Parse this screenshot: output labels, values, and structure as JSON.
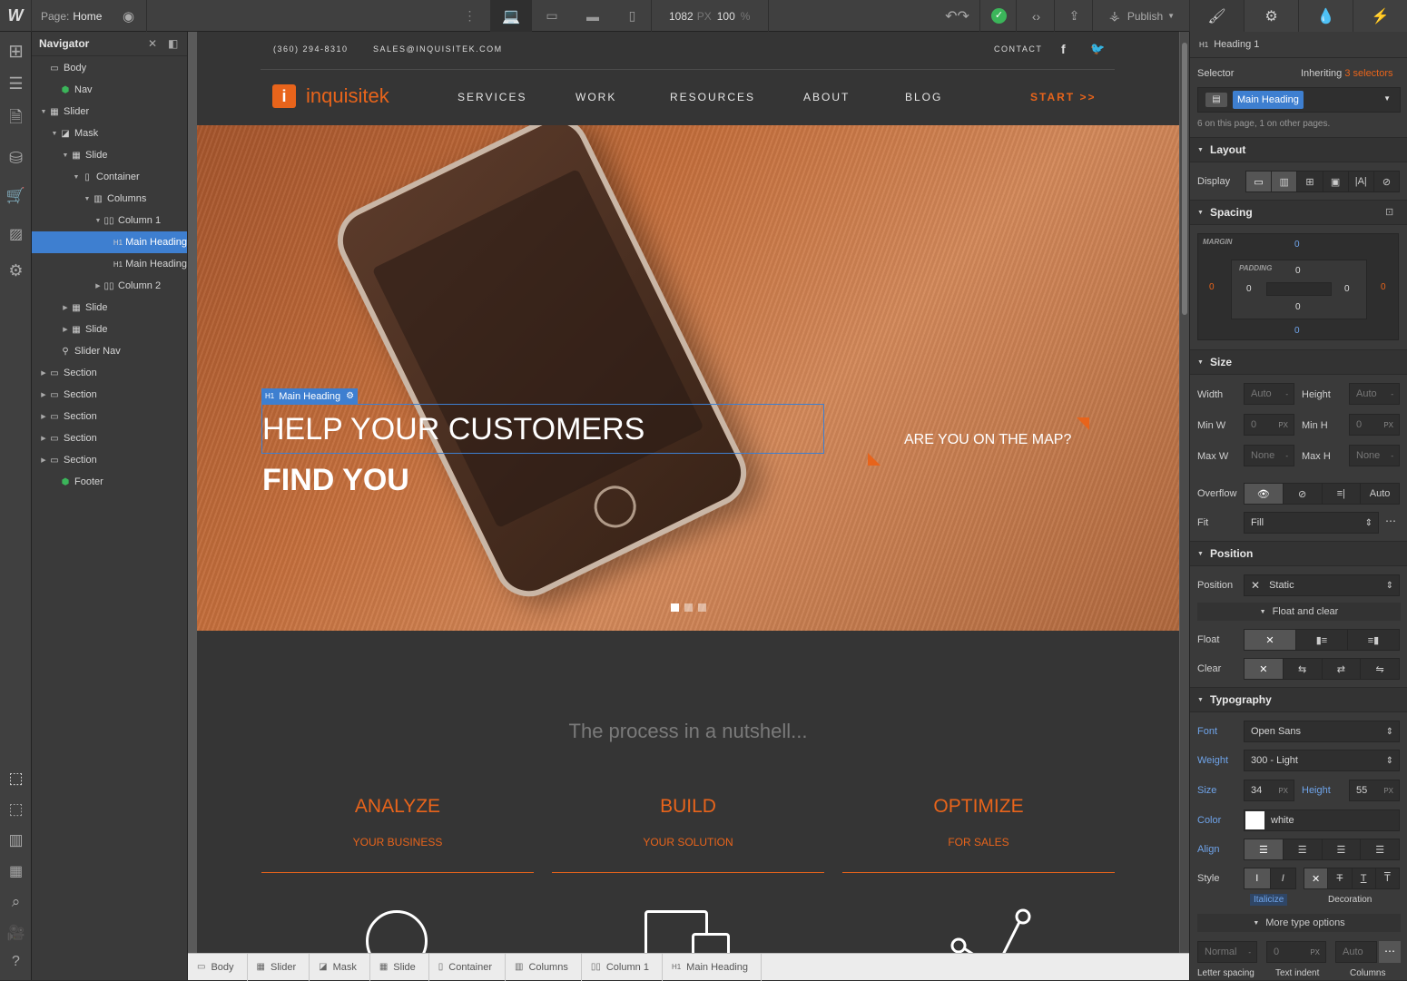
{
  "topbar": {
    "logo": "W",
    "page_label": "Page:",
    "page_name": "Home",
    "width_value": "1082",
    "width_unit": "PX",
    "zoom_value": "100",
    "zoom_unit": "%",
    "publish_label": "Publish"
  },
  "navigator": {
    "title": "Navigator",
    "items": [
      {
        "label": "Body",
        "icon": "▭"
      },
      {
        "label": "Nav",
        "icon": "⬢"
      },
      {
        "label": "Slider",
        "icon": "▦"
      },
      {
        "label": "Mask",
        "icon": "◪"
      },
      {
        "label": "Slide",
        "icon": "▦"
      },
      {
        "label": "Container",
        "icon": "▯"
      },
      {
        "label": "Columns",
        "icon": "▥"
      },
      {
        "label": "Column 1",
        "icon": "▯▯"
      },
      {
        "label": "Main Heading",
        "icon": "H1"
      },
      {
        "label": "Main Heading",
        "icon": "H1"
      },
      {
        "label": "Column 2",
        "icon": "▯▯"
      },
      {
        "label": "Slide",
        "icon": "▦"
      },
      {
        "label": "Slide",
        "icon": "▦"
      },
      {
        "label": "Slider Nav",
        "icon": "⚲"
      },
      {
        "label": "Section",
        "icon": "▭"
      },
      {
        "label": "Section",
        "icon": "▭"
      },
      {
        "label": "Section",
        "icon": "▭"
      },
      {
        "label": "Section",
        "icon": "▭"
      },
      {
        "label": "Section",
        "icon": "▭"
      },
      {
        "label": "Footer",
        "icon": "⬢"
      }
    ]
  },
  "site": {
    "phone": "(360) 294-8310",
    "email": "SALES@INQUISITEK.COM",
    "contact": "CONTACT",
    "brand": "inquisitek",
    "menu": [
      "SERVICES",
      "WORK",
      "RESOURCES",
      "ABOUT",
      "BLOG"
    ],
    "start": "START >>",
    "selected_tag": "Main Heading",
    "hero_line1": "HELP YOUR CUSTOMERS",
    "hero_line2": "FIND YOU",
    "hero_right": "ARE YOU ON THE MAP?",
    "process_title": "The process in a nutshell...",
    "steps": [
      {
        "title": "ANALYZE",
        "sub": "YOUR BUSINESS"
      },
      {
        "title": "BUILD",
        "sub": "YOUR SOLUTION"
      },
      {
        "title": "OPTIMIZE",
        "sub": "FOR SALES"
      }
    ]
  },
  "breadcrumb": [
    "Body",
    "Slider",
    "Mask",
    "Slide",
    "Container",
    "Columns",
    "Column 1",
    "Main Heading"
  ],
  "panel": {
    "element_tag": "H1",
    "element_name": "Heading 1",
    "selector_label": "Selector",
    "inheriting_label": "Inheriting",
    "inheriting_count": "3 selectors",
    "selector_value": "Main Heading",
    "usage": "6 on this page, 1 on other pages.",
    "layout": "Layout",
    "display_label": "Display",
    "spacing": "Spacing",
    "margin_label": "MARGIN",
    "padding_label": "PADDING",
    "margin_top": "0",
    "margin_bottom": "0",
    "margin_left": "0",
    "margin_right": "0",
    "padding_top": "0",
    "padding_bottom": "0",
    "padding_left": "0",
    "padding_right": "0",
    "size": "Size",
    "width_label": "Width",
    "width_val": "Auto",
    "height_label": "Height",
    "height_val": "Auto",
    "minw_label": "Min W",
    "minw_val": "0",
    "minh_label": "Min H",
    "minh_val": "0",
    "maxw_label": "Max W",
    "maxw_val": "None",
    "maxh_label": "Max H",
    "maxh_val": "None",
    "unit_dash": "-",
    "unit_px": "PX",
    "overflow_label": "Overflow",
    "overflow_auto": "Auto",
    "fit_label": "Fit",
    "fit_val": "Fill",
    "position": "Position",
    "position_label": "Position",
    "position_val": "Static",
    "float_clear": "Float and clear",
    "float_label": "Float",
    "clear_label": "Clear",
    "typography": "Typography",
    "font_label": "Font",
    "font_val": "Open Sans",
    "weight_label": "Weight",
    "weight_val": "300 - Light",
    "size_label": "Size",
    "size_val": "34",
    "lh_label": "Height",
    "lh_val": "55",
    "color_label": "Color",
    "color_val": "white",
    "align_label": "Align",
    "style_label": "Style",
    "italicize": "Italicize",
    "decoration": "Decoration",
    "more_type": "More type options",
    "ls_val": "Normal",
    "ti_val": "0",
    "cols_val": "Auto",
    "ls_label": "Letter spacing",
    "ti_label": "Text indent",
    "cols_label": "Columns"
  },
  "colors": {
    "accent": "#e8641b",
    "blue": "#3e7fd0"
  }
}
